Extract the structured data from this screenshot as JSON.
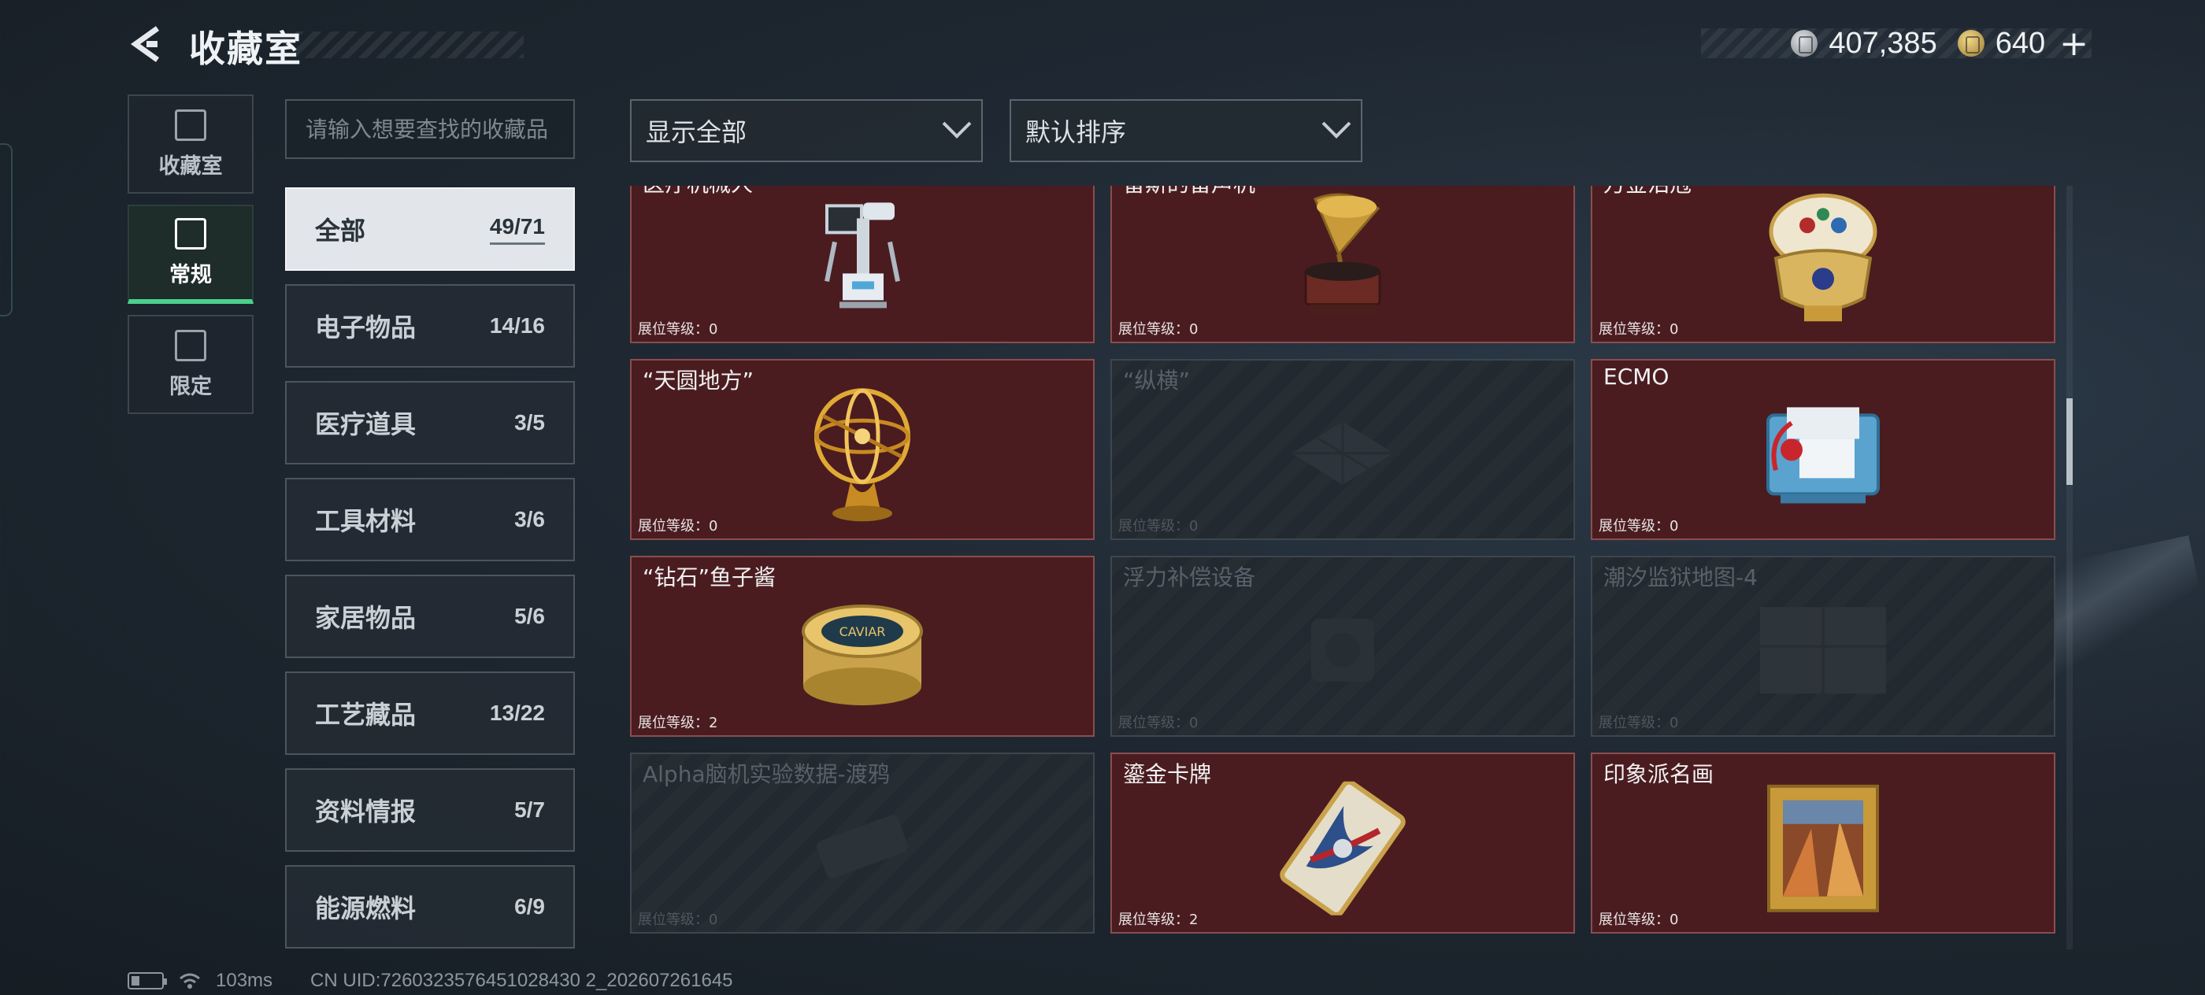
{
  "header": {
    "title": "收藏室",
    "currency": [
      {
        "icon": "silver-coin-icon",
        "value": "407,385"
      },
      {
        "icon": "gold-coin-icon",
        "value": "640"
      }
    ],
    "plus_label": "+"
  },
  "side_nav": [
    {
      "label": "收藏室",
      "icon": "collection-room-icon",
      "active": false
    },
    {
      "label": "常规",
      "icon": "regular-icon",
      "active": true
    },
    {
      "label": "限定",
      "icon": "limited-icon",
      "active": false
    }
  ],
  "search": {
    "placeholder": "请输入想要查找的收藏品",
    "value": ""
  },
  "categories": [
    {
      "name": "全部",
      "count": "49/71",
      "active": true
    },
    {
      "name": "电子物品",
      "count": "14/16"
    },
    {
      "name": "医疗道具",
      "count": "3/5"
    },
    {
      "name": "工具材料",
      "count": "3/6"
    },
    {
      "name": "家居物品",
      "count": "5/6"
    },
    {
      "name": "工艺藏品",
      "count": "13/22"
    },
    {
      "name": "资料情报",
      "count": "5/7"
    },
    {
      "name": "能源燃料",
      "count": "6/9"
    }
  ],
  "filters": {
    "display": "显示全部",
    "sort": "默认排序"
  },
  "items": [
    {
      "name": "医疗机械人",
      "level": "展位等级：0",
      "owned": true,
      "art": "medical-robot"
    },
    {
      "name": "雷斯的留声机",
      "level": "展位等级：0",
      "owned": true,
      "art": "gramophone"
    },
    {
      "name": "万金泪冠",
      "level": "展位等级：0",
      "owned": true,
      "art": "jeweled-egg"
    },
    {
      "name": "“天圆地方”",
      "level": "展位等级：0",
      "owned": true,
      "art": "armillary-sphere"
    },
    {
      "name": "“纵横”",
      "level": "展位等级：0",
      "owned": false,
      "art": "board-game"
    },
    {
      "name": "ECMO",
      "level": "展位等级：0",
      "owned": true,
      "art": "ecmo-machine"
    },
    {
      "name": "“钻石”鱼子酱",
      "level": "展位等级：2",
      "owned": true,
      "art": "caviar-tin"
    },
    {
      "name": "浮力补偿设备",
      "level": "展位等级：0",
      "owned": false,
      "art": "buoyancy-device"
    },
    {
      "name": "潮汐监狱地图-4",
      "level": "展位等级：0",
      "owned": false,
      "art": "prison-map"
    },
    {
      "name": "Alpha脑机实验数据-渡鸦",
      "level": "展位等级：0",
      "owned": false,
      "art": "data-drive"
    },
    {
      "name": "鎏金卡牌",
      "level": "展位等级：2",
      "owned": true,
      "art": "gilded-card"
    },
    {
      "name": "印象派名画",
      "level": "展位等级：0",
      "owned": true,
      "art": "impressionist-painting"
    }
  ],
  "status_bar": {
    "ping": "103ms",
    "uid": "CN UID:7260323576451028430 2_202607261645"
  }
}
